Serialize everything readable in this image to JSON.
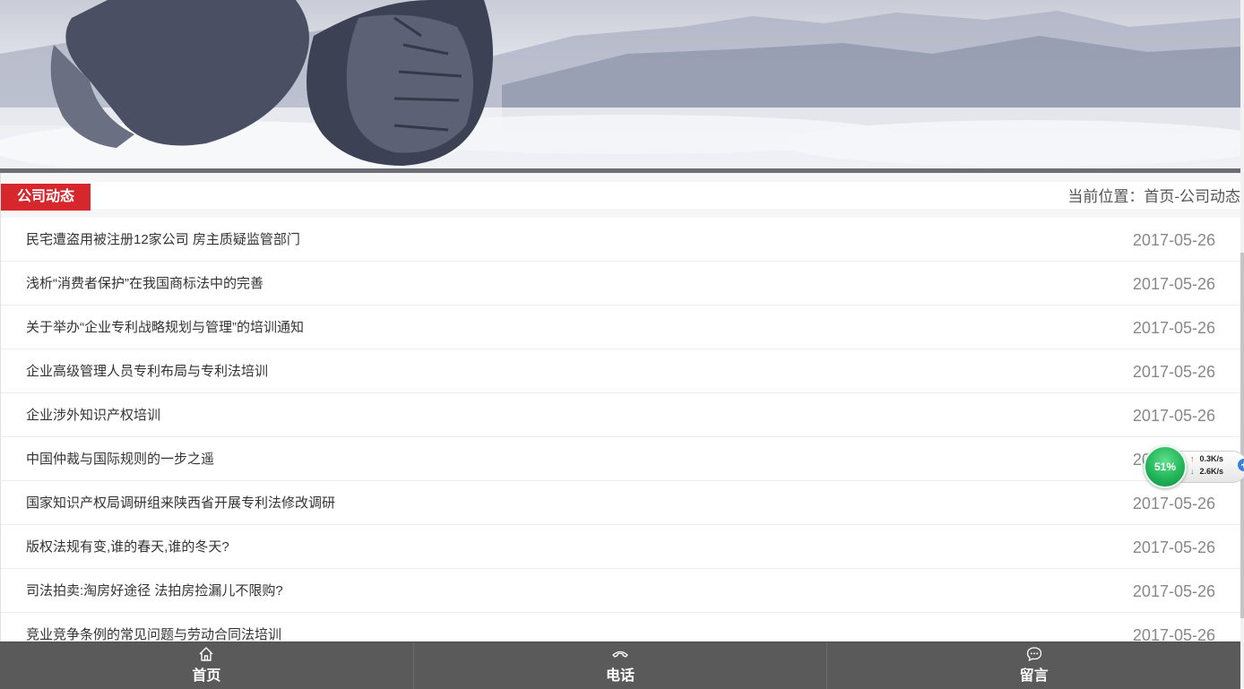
{
  "section": {
    "title": "公司动态",
    "breadcrumb": "当前位置：首页-公司动态"
  },
  "news": [
    {
      "title": "民宅遭盗用被注册12家公司 房主质疑监管部门",
      "date": "2017-05-26"
    },
    {
      "title": "浅析“消费者保护”在我国商标法中的完善",
      "date": "2017-05-26"
    },
    {
      "title": "关于举办“企业专利战略规划与管理”的培训通知",
      "date": "2017-05-26"
    },
    {
      "title": "企业高级管理人员专利布局与专利法培训",
      "date": "2017-05-26"
    },
    {
      "title": "企业涉外知识产权培训",
      "date": "2017-05-26"
    },
    {
      "title": "中国仲裁与国际规则的一步之遥",
      "date": "2017-05-26"
    },
    {
      "title": "国家知识产权局调研组来陕西省开展专利法修改调研",
      "date": "2017-05-26"
    },
    {
      "title": "版权法规有变,谁的春天,谁的冬天?",
      "date": "2017-05-26"
    },
    {
      "title": "司法拍卖:淘房好途径 法拍房捡漏儿不限购?",
      "date": "2017-05-26"
    },
    {
      "title": "竞业竞争条例的常见问题与劳动合同法培训",
      "date": "2017-05-26"
    }
  ],
  "speed_widget": {
    "percent": "51%",
    "upload": "0.3K/s",
    "download": "2.6K/s"
  },
  "bottom_nav": {
    "home": "首页",
    "phone": "电话",
    "message": "留言"
  },
  "colors": {
    "accent": "#d5272c",
    "nav_bg": "#5a5a5a"
  }
}
